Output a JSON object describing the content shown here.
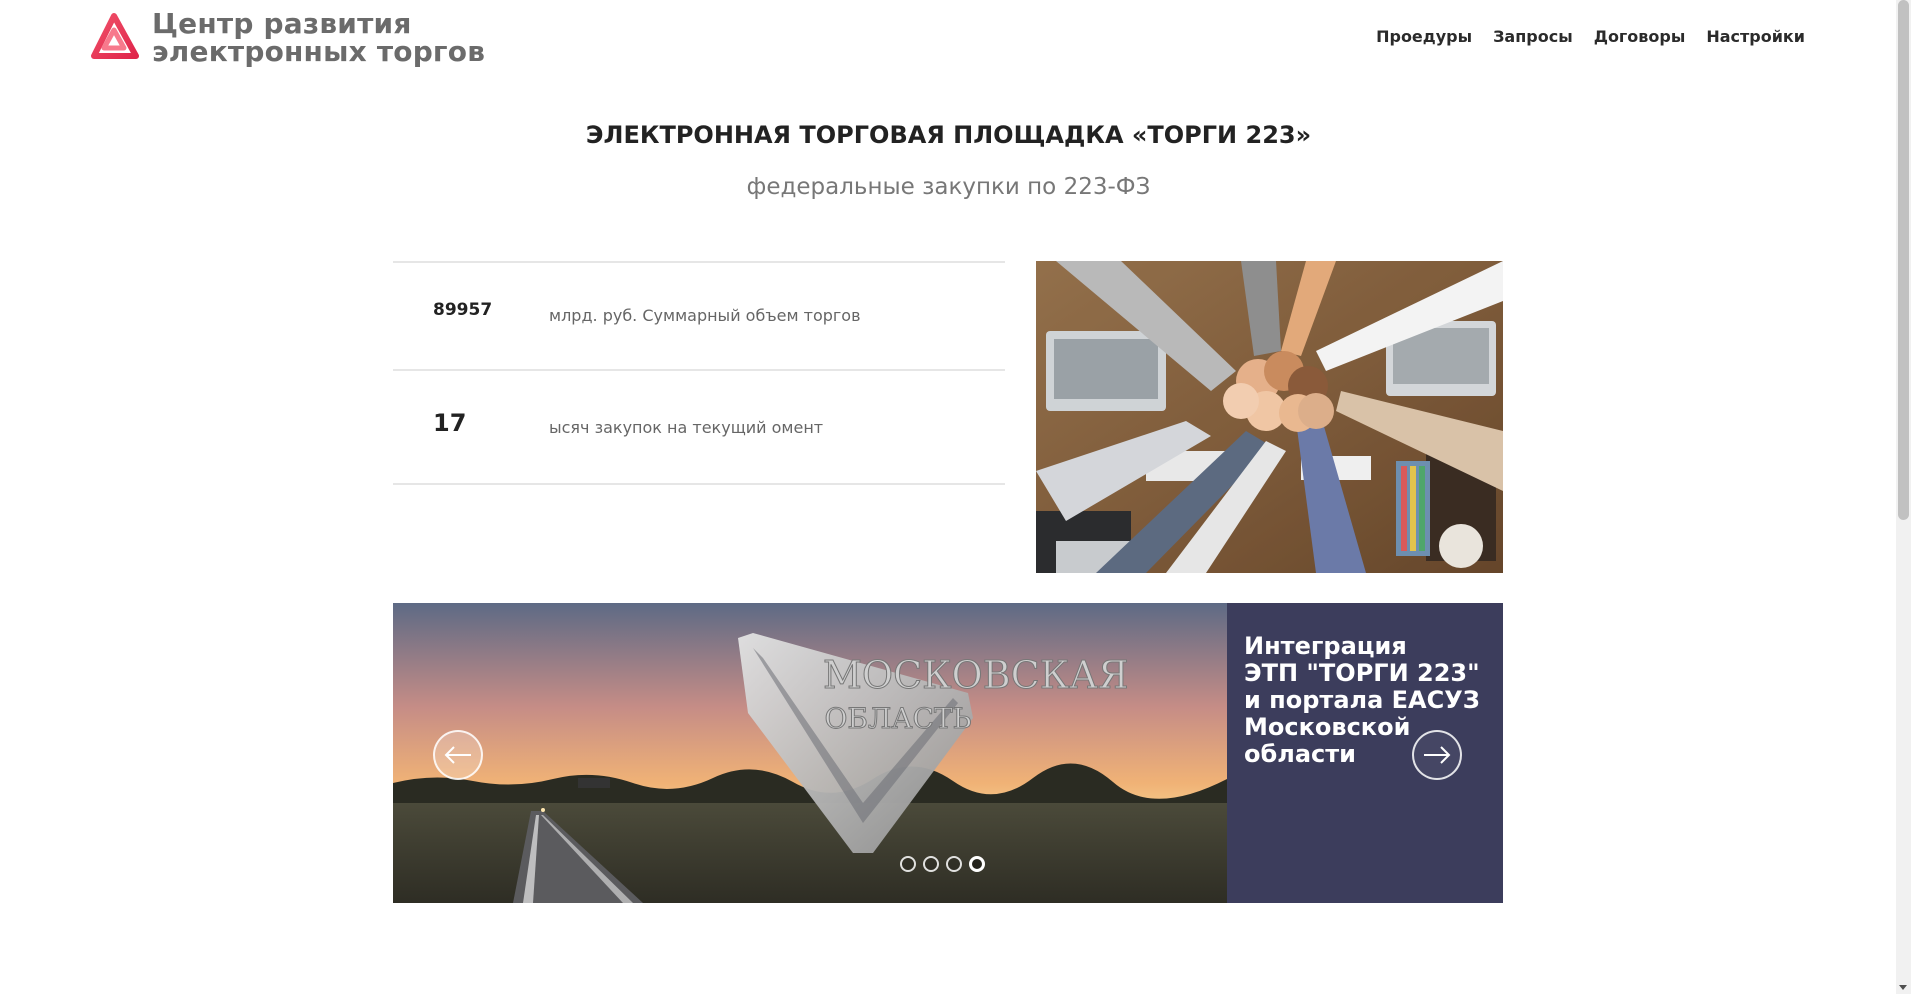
{
  "brand": {
    "logo_name": "triangle-logo-icon",
    "line1": "Центр развития",
    "line2": "электронных торгов",
    "accent_color": "#e8364f"
  },
  "nav": {
    "items": [
      "Проедуры",
      "Запросы",
      "Договоры",
      "Настройки"
    ]
  },
  "hero": {
    "title": "ЭЛЕКТРОННАЯ ТОРГОВАЯ ПЛОЩАДКА «ТОРГИ 223»",
    "subtitle": "федеральные закупки по 223-ФЗ"
  },
  "stats": [
    {
      "value": "89957",
      "label": "млрд. руб. Суммарный объем торгов"
    },
    {
      "value": "17",
      "label": "ысяч закупок на текущий омент"
    }
  ],
  "photo": {
    "icon": "teamwork-photo"
  },
  "slider": {
    "panel_text": "Интеграция\nЭТП \"ТОРГИ 223\"\nи портала ЕАСУЗ\nМосковской области",
    "sign_line1": "МОСКОВСКАЯ",
    "sign_line2": "ОБЛАСТЬ",
    "slide_count": 4,
    "active_slide": 4,
    "panel_color": "#3c3d5c"
  }
}
